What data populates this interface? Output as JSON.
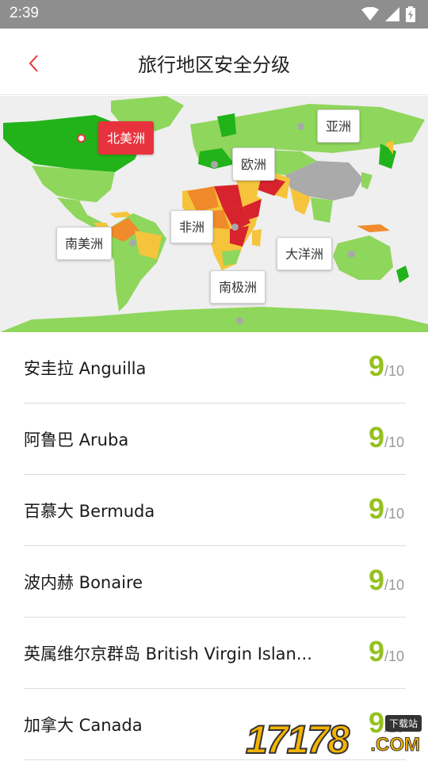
{
  "status_bar": {
    "time": "2:39"
  },
  "header": {
    "title": "旅行地区安全分级"
  },
  "map": {
    "regions": [
      {
        "label": "北美洲",
        "active": true
      },
      {
        "label": "亚洲",
        "active": false
      },
      {
        "label": "欧洲",
        "active": false
      },
      {
        "label": "非洲",
        "active": false
      },
      {
        "label": "南美洲",
        "active": false
      },
      {
        "label": "大洋洲",
        "active": false
      },
      {
        "label": "南极洲",
        "active": false
      }
    ],
    "colors": {
      "safe": "#22b31a",
      "good": "#8fd65c",
      "moderate": "#f6c43c",
      "warning": "#f08a2b",
      "danger": "#d7232d",
      "nodata": "#aaaaaa",
      "ocean": "#efefef"
    }
  },
  "countries": [
    {
      "name": "安圭拉 Anguilla",
      "score": "9",
      "max": "/10"
    },
    {
      "name": "阿鲁巴 Aruba",
      "score": "9",
      "max": "/10"
    },
    {
      "name": "百慕大 Bermuda",
      "score": "9",
      "max": "/10"
    },
    {
      "name": "波内赫 Bonaire",
      "score": "9",
      "max": "/10"
    },
    {
      "name": "英属维尔京群岛 British Virgin Islan...",
      "score": "9",
      "max": "/10"
    },
    {
      "name": "加拿大 Canada",
      "score": "9",
      "max": "/10"
    }
  ],
  "watermark": {
    "digits": "17178",
    "tag": "下载站",
    "domain": ".COM"
  }
}
